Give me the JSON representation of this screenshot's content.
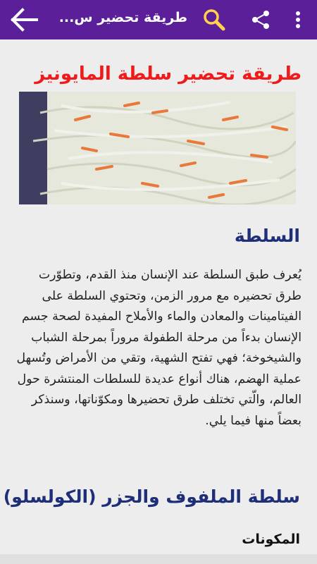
{
  "appbar": {
    "title": "طريقة تحضير س...",
    "back_icon": "arrow-back-icon",
    "search_icon": "search-icon",
    "share_icon": "share-icon",
    "menu_icon": "overflow-menu-icon",
    "color": "#5a1f99"
  },
  "article": {
    "title": "طريقة تحضير سلطة المايونيز",
    "title_color": "#ef1b1b",
    "section1_heading": "السلطة",
    "section1_text": "يُعرف طبق السلطة عند الإنسان منذ القدم، وتطوّرت طرق تحضيره مع مرور الزمن، وتحتوي السلطة على الفيتامينات والمعادن والماء والأملاح المفيدة لصحة جسم الإنسان بدءاً من مرحلة الطفولة مروراً بمرحلة الشباب والشيخوخة؛ فهي تفتح الشهية، وتقي من الأمراض وتُسهل عملية الهضم، هناك أنواع عديدة للسلطات المنتشرة حول العالم، والّتي تختلف طرق تحضيرها ومكوّناتها، وسنذكر بعضاً منها فيما يلي.",
    "section2_heading": "سلطة الملفوف والجزر (الكولسلو)",
    "ingredients_label": "المكونات",
    "heading_color": "#1f2e78"
  }
}
